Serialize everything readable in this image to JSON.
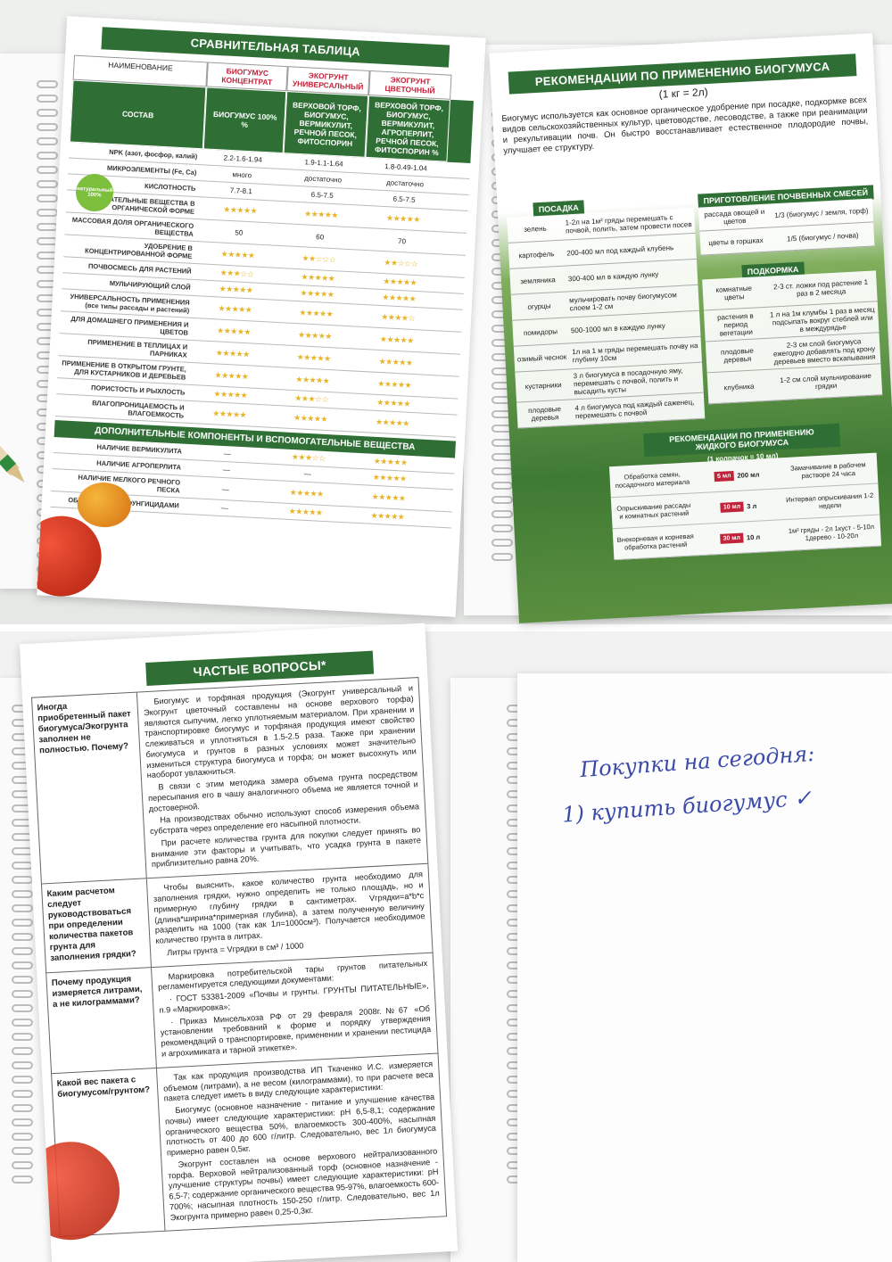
{
  "compare": {
    "title": "СРАВНИТЕЛЬНАЯ ТАБЛИЦА",
    "col_name": "НАИМЕНОВАНИЕ",
    "col1": "БИОГУМУС КОНЦЕНТРАТ",
    "col2": "ЭКОГРУНТ УНИВЕРСАЛЬНЫЙ",
    "col3": "ЭКОГРУНТ ЦВЕТОЧНЫЙ",
    "green_label": "СОСТАВ",
    "green1": "БИОГУМУС 100% %",
    "green2": "ВЕРХОВОЙ ТОРФ, БИОГУМУС, ВЕРМИКУЛИТ, РЕЧНОЙ ПЕСОК, ФИТОСПОРИН",
    "green3": "ВЕРХОВОЙ ТОРФ, БИОГУМУС, ВЕРМИКУЛИТ, АГРОПЕРЛИТ, РЕЧНОЙ ПЕСОК, ФИТОСПОРИН %",
    "badge": "натуральный 100%",
    "rows": [
      {
        "label": "NPK (азот, фосфор, калий)",
        "v1": "2.2-1.6-1.94",
        "v2": "1.9-1.1-1.64",
        "v3": "1.8-0.49-1.04"
      },
      {
        "label": "МИКРОЭЛЕМЕНТЫ (Fe, Ca)",
        "v1": "много",
        "v2": "достаточно",
        "v3": "достаточно"
      },
      {
        "label": "КИСЛОТНОСТЬ",
        "v1": "7.7-8.1",
        "v2": "6.5-7.5",
        "v3": "6.5-7.5"
      },
      {
        "label": "ПИТАТЕЛЬНЫЕ ВЕЩЕСТВА В ОРГАНИЧЕСКОЙ ФОРМЕ",
        "v1": "★★★★★",
        "v2": "★★★★★",
        "v3": "★★★★★"
      },
      {
        "label": "МАССОВАЯ ДОЛЯ ОРГАНИЧЕСКОГО ВЕЩЕСТВА",
        "v1": "50",
        "v2": "60",
        "v3": "70"
      },
      {
        "label": "УДОБРЕНИЕ В КОНЦЕНТРИРОВАННОЙ ФОРМЕ",
        "v1": "★★★★★",
        "v2": "★★☆☆☆",
        "v3": "★★☆☆☆"
      },
      {
        "label": "ПОЧВОСМЕСЬ ДЛЯ РАСТЕНИЙ",
        "v1": "★★★☆☆",
        "v2": "★★★★★",
        "v3": "★★★★★"
      },
      {
        "label": "МУЛЬЧИРУЮЩИЙ СЛОЙ",
        "v1": "★★★★★",
        "v2": "★★★★★",
        "v3": "★★★★★"
      },
      {
        "label": "УНИВЕРСАЛЬНОСТЬ ПРИМЕНЕНИЯ (все типы рассады и растений)",
        "v1": "★★★★★",
        "v2": "★★★★★",
        "v3": "★★★★☆"
      },
      {
        "label": "ДЛЯ ДОМАШНЕГО ПРИМЕНЕНИЯ И ЦВЕТОВ",
        "v1": "★★★★★",
        "v2": "★★★★★",
        "v3": "★★★★★"
      },
      {
        "label": "ПРИМЕНЕНИЕ В ТЕПЛИЦАХ И ПАРНИКАХ",
        "v1": "★★★★★",
        "v2": "★★★★★",
        "v3": "★★★★★"
      },
      {
        "label": "ПРИМЕНЕНИЕ В ОТКРЫТОМ ГРУНТЕ, ДЛЯ КУСТАРНИКОВ И ДЕРЕВЬЕВ",
        "v1": "★★★★★",
        "v2": "★★★★★",
        "v3": "★★★★★"
      },
      {
        "label": "ПОРИСТОСТЬ И РЫХЛОСТЬ",
        "v1": "★★★★★",
        "v2": "★★★☆☆",
        "v3": "★★★★★"
      },
      {
        "label": "ВЛАГОПРОНИЦАЕМОСТЬ И ВЛАГОЕМКОСТЬ",
        "v1": "★★★★★",
        "v2": "★★★★★",
        "v3": "★★★★★"
      }
    ],
    "addon_title": "ДОПОЛНИТЕЛЬНЫЕ КОМПОНЕНТЫ И ВСПОМОГАТЕЛЬНЫЕ ВЕЩЕСТВА",
    "addons": [
      {
        "label": "НАЛИЧИЕ ВЕРМИКУЛИТА",
        "v1": "—",
        "v2": "★★★☆☆",
        "v3": "★★★★★"
      },
      {
        "label": "НАЛИЧИЕ АГРОПЕРЛИТА",
        "v1": "—",
        "v2": "—",
        "v3": "★★★★★"
      },
      {
        "label": "НАЛИЧИЕ МЕЛКОГО РЕЧНОГО ПЕСКА",
        "v1": "—",
        "v2": "★★★★★",
        "v3": "★★★★★"
      },
      {
        "label": "ОБРАБОТКА БИОФУНГИЦИДАМИ",
        "v1": "—",
        "v2": "★★★★★",
        "v3": "★★★★★"
      }
    ]
  },
  "reco": {
    "title": "РЕКОМЕНДАЦИИ ПО ПРИМЕНЕНИЮ БИОГУМУСА",
    "subtitle": "(1 кг = 2л)",
    "intro": "Биогумус используется как основное органическое удобрение при посадке, подкормке всех видов сельскохозяйственных культур, цветоводстве, лесоводстве, а также при реанимации и рекультивации почв. Он быстро восстанавливает естественное плодородие почвы, улучшает ее структуру.",
    "planting_title": "ПОСАДКА",
    "planting": [
      {
        "plant": "зелень",
        "dose": "1-2л на 1м² гряды перемешать с почвой, полить, затем провести посев"
      },
      {
        "plant": "картофель",
        "dose": "200-400 мл под каждый клубень"
      },
      {
        "plant": "земляника",
        "dose": "300-400 мл в каждую лунку"
      },
      {
        "plant": "огурцы",
        "dose": "мульчировать почву биогумусом слоем 1-2 см"
      },
      {
        "plant": "помидоры",
        "dose": "500-1000 мл в каждую лунку"
      },
      {
        "plant": "озимый чеснок",
        "dose": "1л на 1 м гряды перемешать почву на глубину 10см"
      },
      {
        "plant": "кустарники",
        "dose": "3 л биогумуса в посадочную яму, перемешать с почвой, полить и высадить кусты"
      },
      {
        "plant": "плодовые деревья",
        "dose": "4 л биогумуса под каждый саженец, перемешать с почвой"
      }
    ],
    "mix_title": "ПРИГОТОВЛЕНИЕ ПОЧВЕННЫХ СМЕСЕЙ",
    "mix": [
      {
        "use": "рассада овощей и цветов",
        "ratio": "1/3 (биогумус / земля, торф)"
      },
      {
        "use": "цветы в горшках",
        "ratio": "1/5 (биогумус / почва)"
      }
    ],
    "feed_title": "ПОДКОРМКА",
    "feed": [
      {
        "plant": "комнатные цветы",
        "dose": "2-3 ст. ложки под растение 1 раз в 2 месяца"
      },
      {
        "plant": "растения в период вегетации",
        "dose": "1 л на 1м клумбы 1 раз в месяц подсыпать вокруг стеблей или в междурядье"
      },
      {
        "plant": "плодовые деревья",
        "dose": "2-3 см слой биогумуса ежегодно добавлять под крону деревьев вместо вскапывания"
      },
      {
        "plant": "клубника",
        "dose": "1-2 см слой мульчирование грядки"
      }
    ],
    "liquid_title": "РЕКОМЕНДАЦИИ ПО ПРИМЕНЕНИЮ ЖИДКОГО БИОГУМУСА",
    "liquid_sub": "(1 колпачок = 10 мл)",
    "liquid": [
      {
        "use": "Обработка семян, посадочного материала",
        "cap": "5 мл",
        "vol": "200 мл",
        "note": "Замачивание в рабочем растворе 24 часа"
      },
      {
        "use": "Опрыскивание рассады и комнатных растений",
        "cap": "10 мл",
        "vol": "3 л",
        "note": "Интервал опрыскивания 1-2 недели"
      },
      {
        "use": "Внекорневая и корневая обработка растений",
        "cap": "30 мл",
        "vol": "10 л",
        "note": "1м² гряды - 2л 1куст - 5-10л 1дерево - 10-20л"
      }
    ]
  },
  "faq": {
    "title": "ЧАСТЫЕ ВОПРОСЫ*",
    "items": [
      {
        "q": "Иногда приобретенный пакет биогумуса/Экогрунта заполнен не полностью. Почему?",
        "a1": "Биогумус и торфяная продукция (Экогрунт универсальный и Экогрунт цветочный составлены на основе верхового торфа) являются сыпучим, легко уплотняемым материалом. При хранении и транспортировке биогумус и торфяная продукция имеют свойство слеживаться и уплотняться в 1.5-2.5 раза. Также при хранении биогумуса и грунтов в разных условиях может значительно измениться структура биогумуса и торфа; он может высохнуть или наоборот увлажниться.",
        "a2": "В связи с этим методика замера объема грунта посредством пересыпания его в чашу аналогичного объема не является точной и достоверной.",
        "a3": "На производствах обычно используют способ измерения объема субстрата через определение его насыпной плотности.",
        "a4": "При расчете количества грунта для покупки следует принять во внимание эти факторы и учитывать, что усадка грунта в пакете приблизительно равна 20%."
      },
      {
        "q": "Каким расчетом следует руководствоваться при определении количества пакетов грунта для заполнения грядки?",
        "a1": "Чтобы выяснить, какое количество грунта необходимо для заполнения грядки, нужно определить не только площадь, но и примерную глубину грядки в сантиметрах. Vгрядки=a*b*c (длина*ширина*примерная глубина), а затем полученную величину разделить на 1000 (так как 1л=1000см³). Получается необходимое количество грунта в литрах.",
        "a2": "Литры грунта = Vгрядки в см³ / 1000",
        "a3": "",
        "a4": ""
      },
      {
        "q": "Почему продукция измеряется литрами, а не килограммами?",
        "a1": "Маркировка потребительской тары грунтов питательных регламентируется следующими документами:",
        "a2": "· ГОСТ 53381-2009 «Почвы и грунты. ГРУНТЫ ПИТАТЕЛЬНЫЕ», п.9 «Маркировка»;",
        "a3": "· Приказ Минсельхоза РФ от 29 февраля 2008г.№67 «Об установлении требований к форме и порядку утверждения рекомендаций о транспортировке, применении и хранении пестицида и агрохимиката и тарной этикетке».",
        "a4": ""
      },
      {
        "q": "Какой вес пакета с биогумусом/грунтом?",
        "a1": "Так как продукция производства ИП Ткаченко И.С. измеряется объемом (литрами), а не весом (килограммами), то при расчете веса пакета следует иметь в виду следующие характеристики:",
        "a2": "Биогумус (основное назначение - питание и улучшение качества почвы) имеет следующие характеристики: рН 6,5-8,1; содержание органического вещества 50%, влагоемкость 300-400%, насыпная плотность от 400 до 600 г/литр. Следовательно, вес 1л биогумуса примерно равен 0,5кг.",
        "a3": "Экогрунт составлен на основе верхового нейтрализованного торфа. Верховой нейтрализованный торф (основное назначение - улучшение структуры почвы) имеет следующие характеристики: рН 6,5-7; содержание органического вещества 95-97%, влагоемкость 600-700%; насыпная плотность 150-250 г/литр. Следовательно, вес 1л Экогрунта примерно равен 0,25-0,3кг.",
        "a4": ""
      }
    ]
  },
  "note": {
    "line1": "Покупки на сегодня:",
    "line2": "1) купить биогумус ✓"
  }
}
